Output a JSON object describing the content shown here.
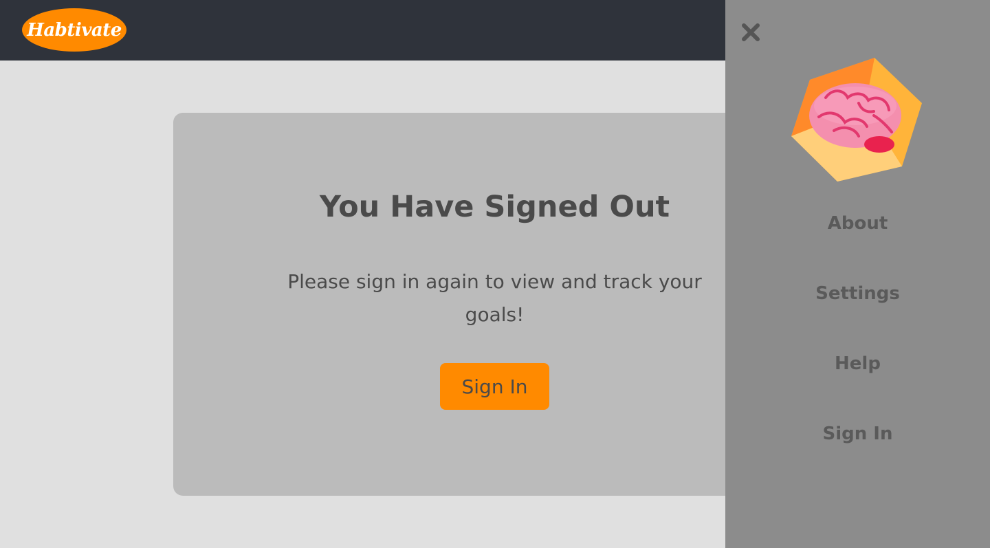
{
  "header": {
    "logo_text": "Habtivate",
    "background_color": "#2f333b",
    "logo_color": "#ff8a00"
  },
  "main": {
    "title": "You Have Signed Out",
    "message": "Please sign in again to view and track your goals!",
    "signin_label": "Sign In",
    "accent_color": "#ff8a00"
  },
  "drawer": {
    "close_icon": "close-icon",
    "badge_icon": "brain-hexagon-icon",
    "items": [
      {
        "label": "About"
      },
      {
        "label": "Settings"
      },
      {
        "label": "Help"
      },
      {
        "label": "Sign In"
      }
    ]
  }
}
